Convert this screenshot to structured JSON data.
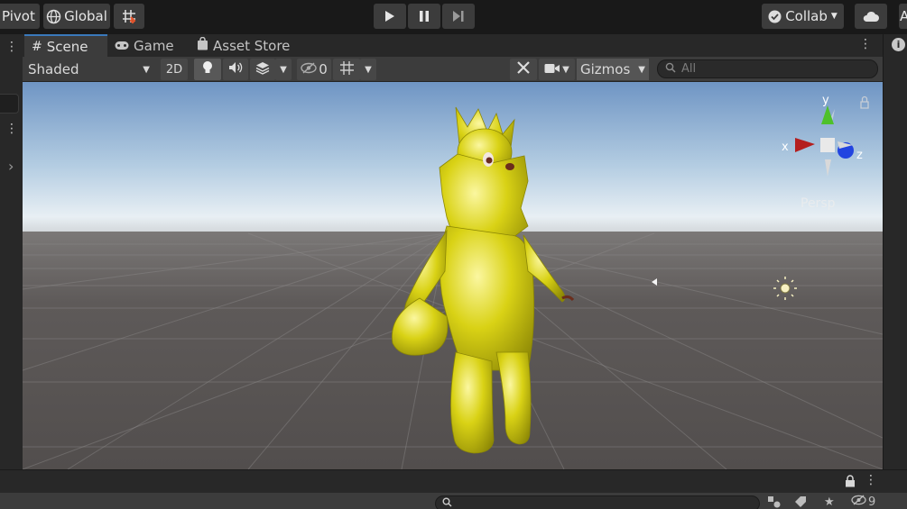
{
  "toolbar": {
    "pivot_label": "Pivot",
    "global_label": "Global",
    "collab_label": "Collab",
    "account_label": "A"
  },
  "scene_tabs": {
    "scene": "Scene",
    "game": "Game",
    "asset_store": "Asset Store"
  },
  "scene_controls": {
    "shading_mode": "Shaded",
    "two_d_label": "2D",
    "hidden_count": "0",
    "gizmos_label": "Gizmos",
    "search_placeholder": "All"
  },
  "viewport": {
    "projection_label": "Persp",
    "axis_x": "x",
    "axis_y": "y",
    "axis_z": "z"
  },
  "bottom_bar": {
    "hidden_count": "9"
  },
  "colors": {
    "accent": "#3a79bb",
    "model": "#d4cf12",
    "axis_x": "#b41e1e",
    "axis_y": "#4ec12b",
    "axis_z": "#2244e0"
  },
  "icons": [
    "globe-icon",
    "grid-snap-icon",
    "play-icon",
    "pause-icon",
    "step-icon",
    "check-icon",
    "cloud-icon",
    "lightbulb-icon",
    "audio-icon",
    "effects-icon",
    "eye-slash-icon",
    "tools-icon",
    "camera-icon",
    "search-icon",
    "lock-icon",
    "info-icon"
  ]
}
